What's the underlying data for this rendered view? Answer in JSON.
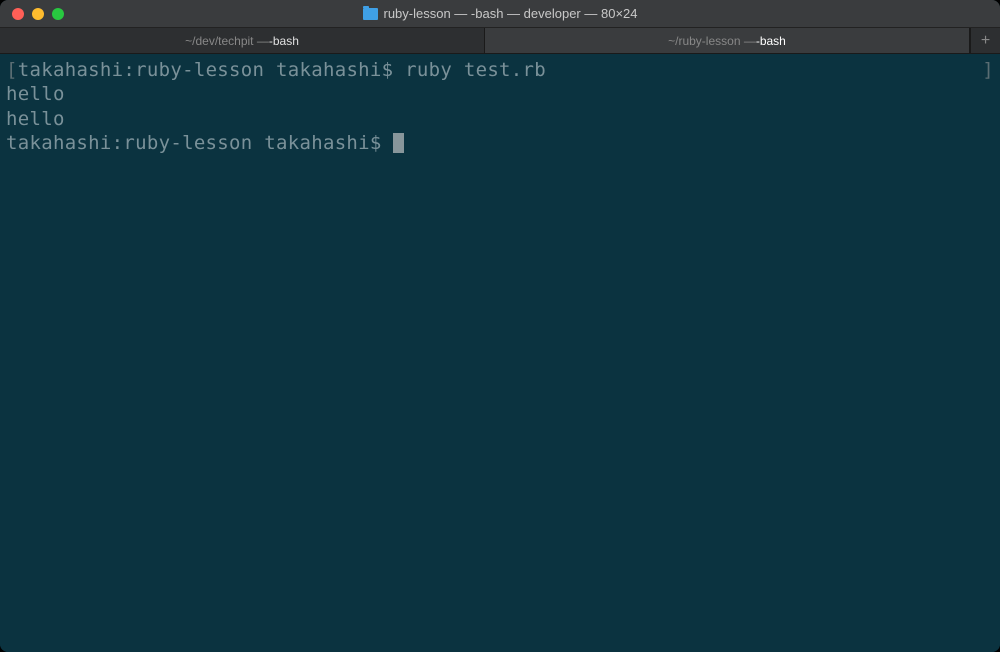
{
  "window": {
    "title": "ruby-lesson — -bash — developer — 80×24"
  },
  "tabs": [
    {
      "path": "~/dev/techpit — ",
      "shell": "-bash"
    },
    {
      "path": "~/ruby-lesson — ",
      "shell": "-bash"
    }
  ],
  "terminal": {
    "lines": [
      {
        "bracket_open": "[",
        "prompt": "takahashi:ruby-lesson takahashi$ ",
        "command": "ruby test.rb",
        "bracket_close": "]"
      },
      {
        "text": "hello"
      },
      {
        "text": "hello"
      },
      {
        "prompt": "takahashi:ruby-lesson takahashi$ ",
        "cursor": true
      }
    ]
  }
}
